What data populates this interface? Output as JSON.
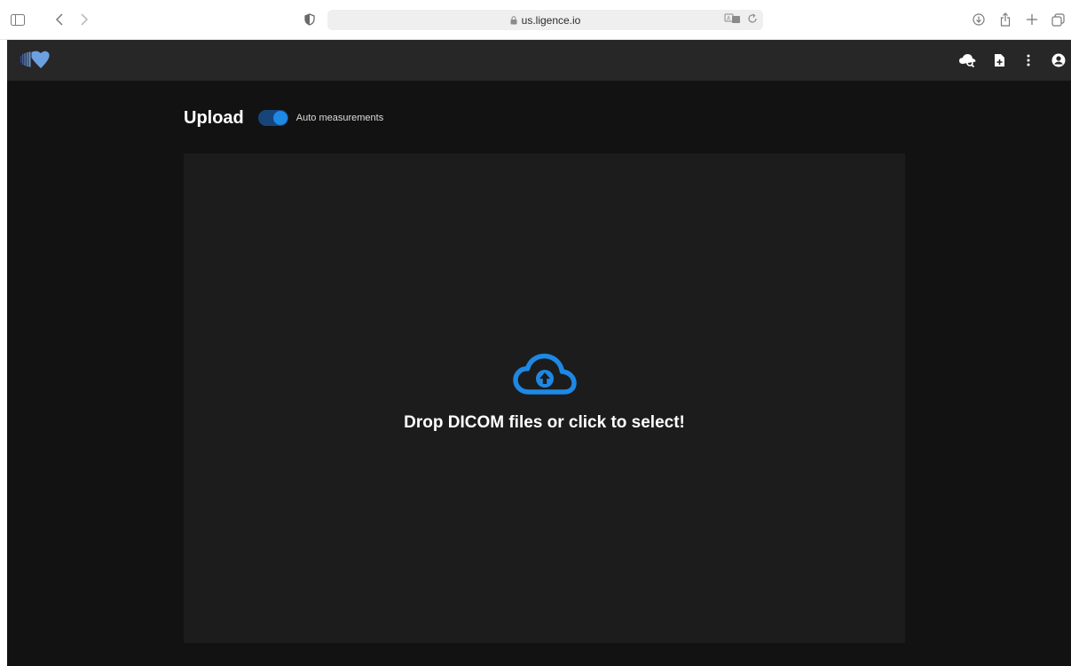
{
  "browser": {
    "url": "us.ligence.io"
  },
  "app": {
    "header": {
      "icons": [
        "cloud-search-icon",
        "add-file-icon",
        "more-vertical-icon",
        "account-circle-icon"
      ]
    },
    "upload": {
      "title": "Upload",
      "auto_measurements_label": "Auto measurements",
      "auto_measurements_enabled": true,
      "accent_color": "#1e88e5"
    },
    "dropzone": {
      "text": "Drop DICOM files or click to select!",
      "icon": "cloud-upload-icon"
    }
  }
}
